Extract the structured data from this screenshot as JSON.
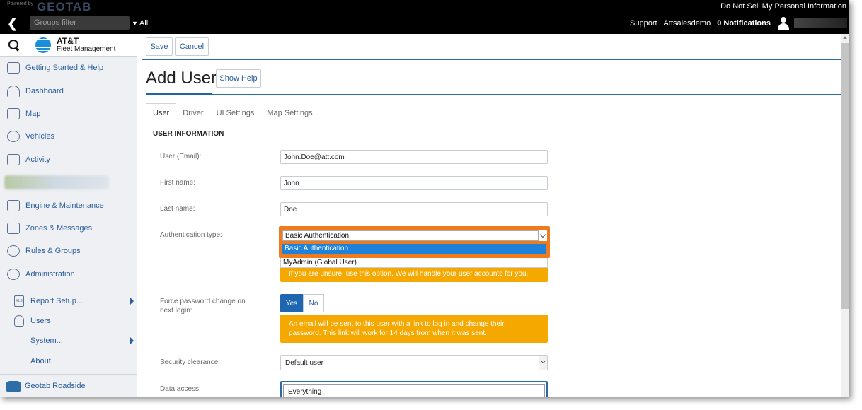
{
  "topbar": {
    "powered_by": "Powered by",
    "logo": "GEOTAB",
    "do_not_sell": "Do Not Sell My Personal Information",
    "groups_placeholder": "Groups filter",
    "all_label": "All",
    "support": "Support",
    "database": "Attsalesdemo",
    "notifications": "0 Notifications"
  },
  "brand": {
    "name": "AT&T",
    "subtitle": "Fleet Management"
  },
  "sidebar": {
    "items": [
      {
        "label": "Getting Started & Help",
        "icon": "help-box-icon"
      },
      {
        "label": "Dashboard",
        "icon": "gauge-icon"
      },
      {
        "label": "Map",
        "icon": "map-icon"
      },
      {
        "label": "Vehicles",
        "icon": "vehicle-icon"
      },
      {
        "label": "Activity",
        "icon": "activity-chart-icon"
      },
      {
        "label": "",
        "icon": "blurred-icon"
      },
      {
        "label": "Engine & Maintenance",
        "icon": "engine-icon"
      },
      {
        "label": "Zones & Messages",
        "icon": "zones-icon"
      },
      {
        "label": "Rules & Groups",
        "icon": "rules-icon"
      },
      {
        "label": "Administration",
        "icon": "gear-icon"
      }
    ],
    "sub_items": [
      {
        "label": "Report Setup...",
        "icon": "xls-icon",
        "icon_text": "XLS"
      },
      {
        "label": "Users",
        "icon": "user-icon"
      },
      {
        "label": "System..."
      },
      {
        "label": "About"
      }
    ],
    "roadside": "Geotab Roadside"
  },
  "toolbar": {
    "save_label": "Save",
    "cancel_label": "Cancel"
  },
  "page": {
    "title": "Add User",
    "show_help": "Show Help"
  },
  "tabs": [
    "User",
    "Driver",
    "UI Settings",
    "Map Settings"
  ],
  "form": {
    "section_title": "USER INFORMATION",
    "email_label": "User (Email):",
    "email_value": "John.Doe@att.com",
    "first_name_label": "First name:",
    "first_name_value": "John",
    "last_name_label": "Last name:",
    "last_name_value": "Doe",
    "auth_label": "Authentication type:",
    "auth_value": "Basic Authentication",
    "auth_options": [
      "Basic Authentication",
      "MyAdmin (Global User)"
    ],
    "auth_hint": "If you are unsure, use this option. We will handle your user accounts for you.",
    "force_pw_label_1": "Force password change on",
    "force_pw_label_2": "next login:",
    "yes": "Yes",
    "no": "No",
    "force_pw_hint_1": "An email will be sent to this user with a link to log in and change their",
    "force_pw_hint_2": "password. This link will work for 14 days from when it was sent.",
    "security_label": "Security clearance:",
    "security_value": "Default user",
    "data_access_label": "Data access:",
    "data_access_value": "Everything"
  },
  "colors": {
    "accent": "#1f66b0",
    "highlight_orange": "#f07b1f",
    "hint_yellow": "#f5a800",
    "link": "#2a5d9a"
  }
}
